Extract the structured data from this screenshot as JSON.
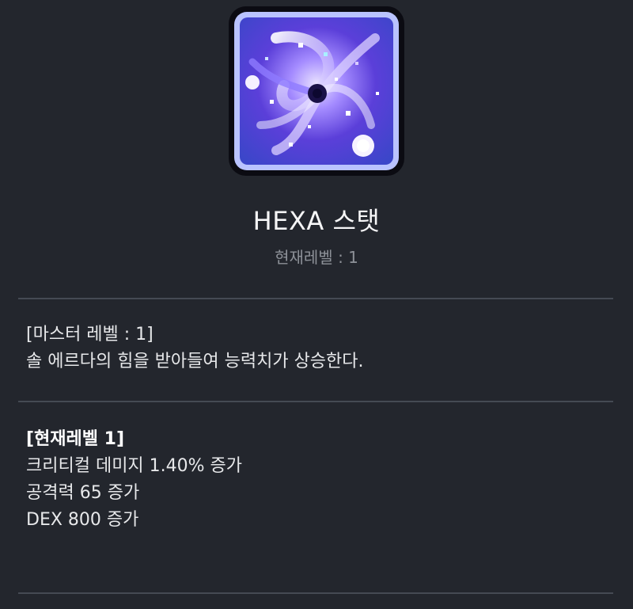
{
  "skill": {
    "icon": "hexa-stat-galaxy-icon",
    "title": "HEXA 스탯",
    "current_level_label": "현재레벨 : 1"
  },
  "description": {
    "master_level": "[마스터 레벨 : 1]",
    "text": "솔 에르다의 힘을 받아들여 능력치가 상승한다."
  },
  "effects": {
    "header": "[현재레벨 1]",
    "lines": [
      "크리티컬 데미지 1.40% 증가",
      "공격력 65 증가",
      "DEX 800 증가"
    ]
  },
  "colors": {
    "background": "#23262d",
    "divider": "#454a53",
    "muted_text": "#8d9198",
    "icon_frame": "#b9c3ff",
    "icon_nebula": "#5b3fd9"
  }
}
